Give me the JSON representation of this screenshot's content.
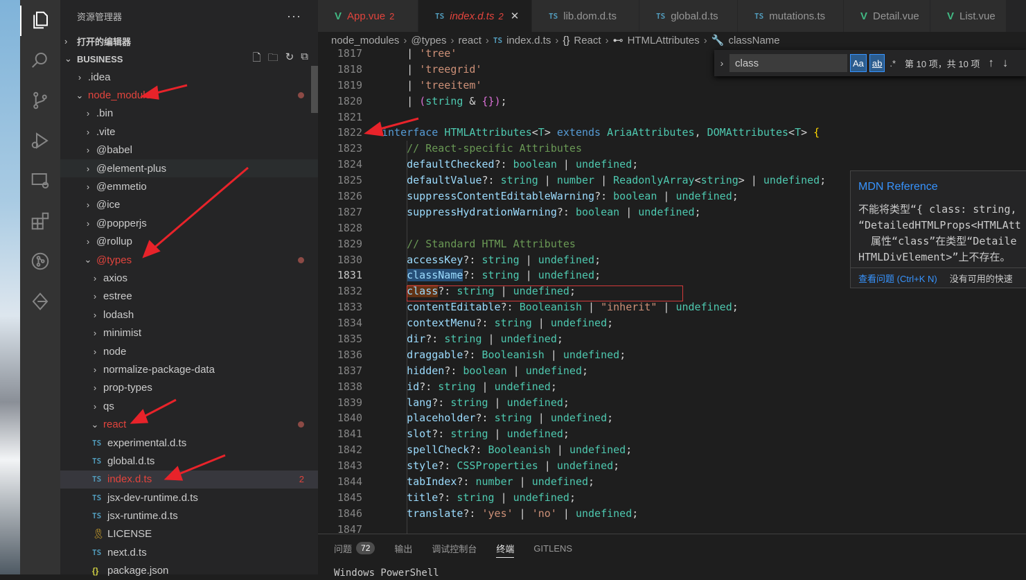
{
  "sidebar": {
    "title": "资源管理器",
    "more": "···",
    "open_editors": "打开的编辑器",
    "project": "BUSINESS",
    "tree": [
      {
        "label": ".idea",
        "chev": "›",
        "indent": 0
      },
      {
        "label": "node_modules",
        "chev": "⌄",
        "indent": 0,
        "modified": true
      },
      {
        "label": ".bin",
        "chev": "›",
        "indent": 1
      },
      {
        "label": ".vite",
        "chev": "›",
        "indent": 1
      },
      {
        "label": "@babel",
        "chev": "›",
        "indent": 1
      },
      {
        "label": "@element-plus",
        "chev": "›",
        "indent": 1
      },
      {
        "label": "@emmetio",
        "chev": "›",
        "indent": 1
      },
      {
        "label": "@ice",
        "chev": "›",
        "indent": 1
      },
      {
        "label": "@popperjs",
        "chev": "›",
        "indent": 1
      },
      {
        "label": "@rollup",
        "chev": "›",
        "indent": 1
      },
      {
        "label": "@types",
        "chev": "⌄",
        "indent": 1,
        "modified": true
      },
      {
        "label": "axios",
        "chev": "›",
        "indent": 2
      },
      {
        "label": "estree",
        "chev": "›",
        "indent": 2
      },
      {
        "label": "lodash",
        "chev": "›",
        "indent": 2
      },
      {
        "label": "minimist",
        "chev": "›",
        "indent": 2
      },
      {
        "label": "node",
        "chev": "›",
        "indent": 2
      },
      {
        "label": "normalize-package-data",
        "chev": "›",
        "indent": 2
      },
      {
        "label": "prop-types",
        "chev": "›",
        "indent": 2
      },
      {
        "label": "qs",
        "chev": "›",
        "indent": 2
      },
      {
        "label": "react",
        "chev": "⌄",
        "indent": 2,
        "modified": true
      },
      {
        "label": "experimental.d.ts",
        "icon": "TS",
        "indent": 3
      },
      {
        "label": "global.d.ts",
        "icon": "TS",
        "indent": 3
      },
      {
        "label": "index.d.ts",
        "icon": "TS",
        "indent": 3,
        "modified": true,
        "count": "2"
      },
      {
        "label": "jsx-dev-runtime.d.ts",
        "icon": "TS",
        "indent": 3
      },
      {
        "label": "jsx-runtime.d.ts",
        "icon": "TS",
        "indent": 3
      },
      {
        "label": "LICENSE",
        "icon": "LIC",
        "indent": 3
      },
      {
        "label": "next.d.ts",
        "icon": "TS",
        "indent": 3
      },
      {
        "label": "package.json",
        "icon": "{}",
        "indent": 3
      }
    ]
  },
  "tabs": [
    {
      "icon": "V",
      "label": "App.vue",
      "count": "2",
      "kind": "vue-mod"
    },
    {
      "icon": "TS",
      "label": "index.d.ts",
      "count": "2",
      "kind": "active"
    },
    {
      "icon": "TS",
      "label": "lib.dom.d.ts",
      "kind": ""
    },
    {
      "icon": "TS",
      "label": "global.d.ts",
      "kind": ""
    },
    {
      "icon": "TS",
      "label": "mutations.ts",
      "kind": ""
    },
    {
      "icon": "V",
      "label": "Detail.vue",
      "kind": ""
    },
    {
      "icon": "V",
      "label": "List.vue",
      "kind": ""
    }
  ],
  "breadcrumb": {
    "parts": [
      "node_modules",
      "@types",
      "react",
      "index.d.ts",
      "React",
      "HTMLAttributes",
      "className"
    ],
    "ts_badge": "TS",
    "react_sym": "{}"
  },
  "find": {
    "value": "class",
    "match_case": "Aa",
    "whole_word": "ab",
    "regex": ".*",
    "status": "第 10 项，共 10 项"
  },
  "hover": {
    "title": "MDN Reference",
    "message": "不能将类型“{ class: string,\n“DetailedHTMLProps<HTMLAtt\n  属性“class”在类型“Detaile\nHTMLDivElement>”上不存在。",
    "view_problem": "查看问题 (Ctrl+K N)",
    "no_fix": "没有可用的快速"
  },
  "editor": {
    "current_line": "1831",
    "lines": [
      {
        "n": "1817",
        "code": [
          [
            "pn",
            "    | "
          ],
          [
            "st",
            "'tree'"
          ]
        ]
      },
      {
        "n": "1818",
        "code": [
          [
            "pn",
            "    | "
          ],
          [
            "st",
            "'treegrid'"
          ]
        ]
      },
      {
        "n": "1819",
        "code": [
          [
            "pn",
            "    | "
          ],
          [
            "st",
            "'treeitem'"
          ]
        ]
      },
      {
        "n": "1820",
        "code": [
          [
            "pn",
            "    | "
          ],
          [
            "bp",
            "("
          ],
          [
            "ty",
            "string"
          ],
          [
            "pn",
            " & "
          ],
          [
            "bp",
            "{}"
          ],
          [
            "bp",
            ")"
          ],
          [
            "pn",
            ";"
          ]
        ]
      },
      {
        "n": "1821",
        "code": []
      },
      {
        "n": "1822",
        "code": [
          [
            "kw",
            "interface "
          ],
          [
            "ty",
            "HTMLAttributes"
          ],
          [
            "pn",
            "<"
          ],
          [
            "ty",
            "T"
          ],
          [
            "pn",
            "> "
          ],
          [
            "kw",
            "extends "
          ],
          [
            "ty",
            "AriaAttributes"
          ],
          [
            "pn",
            ", "
          ],
          [
            "ty",
            "DOMAttributes"
          ],
          [
            "pn",
            "<"
          ],
          [
            "ty",
            "T"
          ],
          [
            "pn",
            "> "
          ],
          [
            "br",
            "{"
          ]
        ]
      },
      {
        "n": "1823",
        "code": [
          [
            "pn",
            "    "
          ],
          [
            "cm",
            "// React-specific Attributes"
          ]
        ]
      },
      {
        "n": "1824",
        "code": [
          [
            "pn",
            "    "
          ],
          [
            "pr",
            "defaultChecked"
          ],
          [
            "pn",
            "?: "
          ],
          [
            "ty",
            "boolean"
          ],
          [
            "pn",
            " | "
          ],
          [
            "ty",
            "undefined"
          ],
          [
            "pn",
            ";"
          ]
        ]
      },
      {
        "n": "1825",
        "code": [
          [
            "pn",
            "    "
          ],
          [
            "pr",
            "defaultValue"
          ],
          [
            "pn",
            "?: "
          ],
          [
            "ty",
            "string"
          ],
          [
            "pn",
            " | "
          ],
          [
            "ty",
            "number"
          ],
          [
            "pn",
            " | "
          ],
          [
            "ty",
            "ReadonlyArray"
          ],
          [
            "pn",
            "<"
          ],
          [
            "ty",
            "string"
          ],
          [
            "pn",
            "> | "
          ],
          [
            "ty",
            "undefined"
          ],
          [
            "pn",
            ";"
          ]
        ]
      },
      {
        "n": "1826",
        "code": [
          [
            "pn",
            "    "
          ],
          [
            "pr",
            "suppressContentEditableWarning"
          ],
          [
            "pn",
            "?: "
          ],
          [
            "ty",
            "boolean"
          ],
          [
            "pn",
            " | "
          ],
          [
            "ty",
            "undefined"
          ],
          [
            "pn",
            ";"
          ]
        ]
      },
      {
        "n": "1827",
        "code": [
          [
            "pn",
            "    "
          ],
          [
            "pr",
            "suppressHydrationWarning"
          ],
          [
            "pn",
            "?: "
          ],
          [
            "ty",
            "boolean"
          ],
          [
            "pn",
            " | "
          ],
          [
            "ty",
            "undefined"
          ],
          [
            "pn",
            ";"
          ]
        ]
      },
      {
        "n": "1828",
        "code": []
      },
      {
        "n": "1829",
        "code": [
          [
            "pn",
            "    "
          ],
          [
            "cm",
            "// Standard HTML Attributes"
          ]
        ]
      },
      {
        "n": "1830",
        "code": [
          [
            "pn",
            "    "
          ],
          [
            "pr",
            "accessKey"
          ],
          [
            "pn",
            "?: "
          ],
          [
            "ty",
            "string"
          ],
          [
            "pn",
            " | "
          ],
          [
            "ty",
            "undefined"
          ],
          [
            "pn",
            ";"
          ]
        ]
      },
      {
        "n": "1831",
        "code": [
          [
            "pn",
            "    "
          ],
          [
            "pr hl",
            "className"
          ],
          [
            "pn",
            "?: "
          ],
          [
            "ty",
            "string"
          ],
          [
            "pn",
            " | "
          ],
          [
            "ty",
            "undefined"
          ],
          [
            "pn",
            ";"
          ]
        ]
      },
      {
        "n": "1832",
        "code": [
          [
            "pn",
            "    "
          ],
          [
            "pr hlf",
            "class"
          ],
          [
            "pn",
            "?: "
          ],
          [
            "ty",
            "string"
          ],
          [
            "pn",
            " | "
          ],
          [
            "ty",
            "undefined"
          ],
          [
            "pn",
            ";"
          ]
        ]
      },
      {
        "n": "1833",
        "code": [
          [
            "pn",
            "    "
          ],
          [
            "pr",
            "contentEditable"
          ],
          [
            "pn",
            "?: "
          ],
          [
            "ty",
            "Booleanish"
          ],
          [
            "pn",
            " | "
          ],
          [
            "st",
            "\"inherit\""
          ],
          [
            "pn",
            " | "
          ],
          [
            "ty",
            "undefined"
          ],
          [
            "pn",
            ";"
          ]
        ]
      },
      {
        "n": "1834",
        "code": [
          [
            "pn",
            "    "
          ],
          [
            "pr",
            "contextMenu"
          ],
          [
            "pn",
            "?: "
          ],
          [
            "ty",
            "string"
          ],
          [
            "pn",
            " | "
          ],
          [
            "ty",
            "undefined"
          ],
          [
            "pn",
            ";"
          ]
        ]
      },
      {
        "n": "1835",
        "code": [
          [
            "pn",
            "    "
          ],
          [
            "pr",
            "dir"
          ],
          [
            "pn",
            "?: "
          ],
          [
            "ty",
            "string"
          ],
          [
            "pn",
            " | "
          ],
          [
            "ty",
            "undefined"
          ],
          [
            "pn",
            ";"
          ]
        ]
      },
      {
        "n": "1836",
        "code": [
          [
            "pn",
            "    "
          ],
          [
            "pr",
            "draggable"
          ],
          [
            "pn",
            "?: "
          ],
          [
            "ty",
            "Booleanish"
          ],
          [
            "pn",
            " | "
          ],
          [
            "ty",
            "undefined"
          ],
          [
            "pn",
            ";"
          ]
        ]
      },
      {
        "n": "1837",
        "code": [
          [
            "pn",
            "    "
          ],
          [
            "pr",
            "hidden"
          ],
          [
            "pn",
            "?: "
          ],
          [
            "ty",
            "boolean"
          ],
          [
            "pn",
            " | "
          ],
          [
            "ty",
            "undefined"
          ],
          [
            "pn",
            ";"
          ]
        ]
      },
      {
        "n": "1838",
        "code": [
          [
            "pn",
            "    "
          ],
          [
            "pr",
            "id"
          ],
          [
            "pn",
            "?: "
          ],
          [
            "ty",
            "string"
          ],
          [
            "pn",
            " | "
          ],
          [
            "ty",
            "undefined"
          ],
          [
            "pn",
            ";"
          ]
        ]
      },
      {
        "n": "1839",
        "code": [
          [
            "pn",
            "    "
          ],
          [
            "pr",
            "lang"
          ],
          [
            "pn",
            "?: "
          ],
          [
            "ty",
            "string"
          ],
          [
            "pn",
            " | "
          ],
          [
            "ty",
            "undefined"
          ],
          [
            "pn",
            ";"
          ]
        ]
      },
      {
        "n": "1840",
        "code": [
          [
            "pn",
            "    "
          ],
          [
            "pr",
            "placeholder"
          ],
          [
            "pn",
            "?: "
          ],
          [
            "ty",
            "string"
          ],
          [
            "pn",
            " | "
          ],
          [
            "ty",
            "undefined"
          ],
          [
            "pn",
            ";"
          ]
        ]
      },
      {
        "n": "1841",
        "code": [
          [
            "pn",
            "    "
          ],
          [
            "pr",
            "slot"
          ],
          [
            "pn",
            "?: "
          ],
          [
            "ty",
            "string"
          ],
          [
            "pn",
            " | "
          ],
          [
            "ty",
            "undefined"
          ],
          [
            "pn",
            ";"
          ]
        ]
      },
      {
        "n": "1842",
        "code": [
          [
            "pn",
            "    "
          ],
          [
            "pr",
            "spellCheck"
          ],
          [
            "pn",
            "?: "
          ],
          [
            "ty",
            "Booleanish"
          ],
          [
            "pn",
            " | "
          ],
          [
            "ty",
            "undefined"
          ],
          [
            "pn",
            ";"
          ]
        ]
      },
      {
        "n": "1843",
        "code": [
          [
            "pn",
            "    "
          ],
          [
            "pr",
            "style"
          ],
          [
            "pn",
            "?: "
          ],
          [
            "ty",
            "CSSProperties"
          ],
          [
            "pn",
            " | "
          ],
          [
            "ty",
            "undefined"
          ],
          [
            "pn",
            ";"
          ]
        ]
      },
      {
        "n": "1844",
        "code": [
          [
            "pn",
            "    "
          ],
          [
            "pr",
            "tabIndex"
          ],
          [
            "pn",
            "?: "
          ],
          [
            "ty",
            "number"
          ],
          [
            "pn",
            " | "
          ],
          [
            "ty",
            "undefined"
          ],
          [
            "pn",
            ";"
          ]
        ]
      },
      {
        "n": "1845",
        "code": [
          [
            "pn",
            "    "
          ],
          [
            "pr",
            "title"
          ],
          [
            "pn",
            "?: "
          ],
          [
            "ty",
            "string"
          ],
          [
            "pn",
            " | "
          ],
          [
            "ty",
            "undefined"
          ],
          [
            "pn",
            ";"
          ]
        ]
      },
      {
        "n": "1846",
        "code": [
          [
            "pn",
            "    "
          ],
          [
            "pr",
            "translate"
          ],
          [
            "pn",
            "?: "
          ],
          [
            "st",
            "'yes'"
          ],
          [
            "pn",
            " | "
          ],
          [
            "st",
            "'no'"
          ],
          [
            "pn",
            " | "
          ],
          [
            "ty",
            "undefined"
          ],
          [
            "pn",
            ";"
          ]
        ]
      },
      {
        "n": "1847",
        "code": []
      }
    ]
  },
  "panel": {
    "tabs": [
      {
        "label": "问题",
        "badge": "72"
      },
      {
        "label": "输出"
      },
      {
        "label": "调试控制台"
      },
      {
        "label": "终端",
        "active": true
      },
      {
        "label": "GITLENS"
      }
    ],
    "terminal_text": "Windows PowerShell"
  },
  "colors": {
    "modified": "#e2443d",
    "accent_blue": "#3794ff",
    "annotation_red": "#e8232a"
  }
}
